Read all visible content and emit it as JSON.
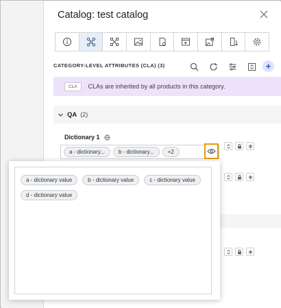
{
  "window": {
    "title": "Catalog: test catalog"
  },
  "toolbar": {
    "tabs": [
      {
        "icon": "info-icon",
        "active": false
      },
      {
        "icon": "hierarchy-icon",
        "active": true
      },
      {
        "icon": "nodes-icon",
        "active": false
      },
      {
        "icon": "image-icon",
        "active": false
      },
      {
        "icon": "document-settings-icon",
        "active": false
      },
      {
        "icon": "video-icon",
        "active": false
      },
      {
        "icon": "image-export-icon",
        "active": false
      },
      {
        "icon": "file-download-icon",
        "active": false
      },
      {
        "icon": "cog-icon",
        "active": false
      }
    ]
  },
  "cla": {
    "header": "CATEGORY-LEVEL ATTRIBUTES (CLA) (3)",
    "header_icons": [
      "search-icon",
      "refresh-icon",
      "list-settings-icon",
      "collapse-icon"
    ],
    "add_label": "+"
  },
  "banner": {
    "badge": "CLA",
    "text": "CLAs are inherited by all products in this category."
  },
  "group": {
    "title": "QA",
    "count": "(2)"
  },
  "attribute": {
    "label": "Dictionary 1",
    "chips": [
      "a - dictionary...",
      "b - dictionary...",
      "+2"
    ]
  },
  "popover": {
    "values": [
      "a - dictionary value",
      "b - dictionary value",
      "c - dictionary value",
      "d - dictionary value"
    ]
  },
  "colors": {
    "accent": "#e59a0f",
    "banner": "#ece3fb",
    "active_tab": "#e7eef7",
    "primary": "#2851b8"
  }
}
